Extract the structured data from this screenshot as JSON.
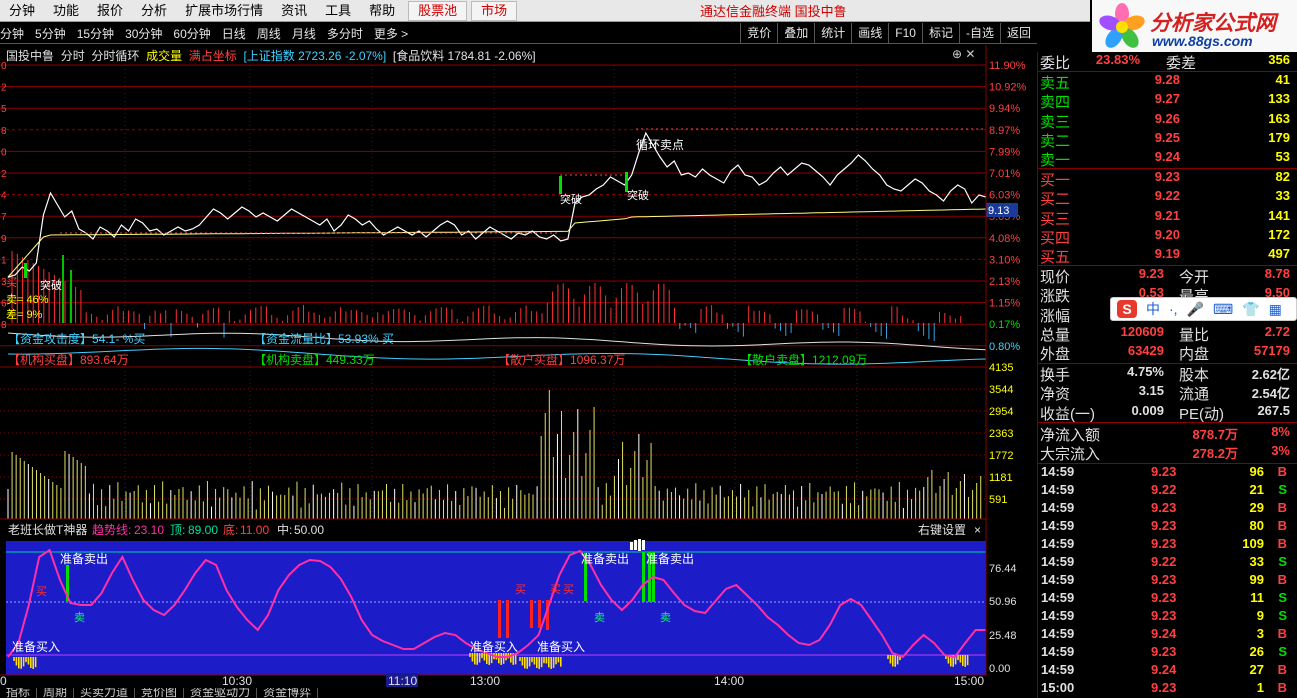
{
  "menu": {
    "items": [
      "分钟",
      "功能",
      "报价",
      "分析",
      "扩展市场行情",
      "资讯",
      "工具",
      "帮助"
    ],
    "stock_pool": "股票池",
    "market": "市场",
    "title": "通达信金融终端  国投中鲁"
  },
  "periods": [
    "分钟",
    "5分钟",
    "15分钟",
    "30分钟",
    "60分钟",
    "日线",
    "周线",
    "月线",
    "多分时",
    "更多 >"
  ],
  "tools": [
    "竞价",
    "叠加",
    "统计",
    "画线",
    "F10",
    "标记",
    "-自选",
    "返回"
  ],
  "logo": {
    "text": "分析家公式网",
    "url": "www.88gs.com"
  },
  "info": {
    "stock": "国投中鲁",
    "mode1": "分时",
    "mode2": "分时循环",
    "vol": "成交量",
    "coord": "满占坐标",
    "index": "[上证指数 2723.26 -2.07%]",
    "sector": "[食品饮料 1784.81 -2.06%]"
  },
  "price_axis": [
    "11.90%",
    "10.92%",
    "9.94%",
    "8.97%",
    "7.99%",
    "7.01%",
    "6.03%",
    "5.05%",
    "4.08%",
    "3.10%",
    "2.13%",
    "1.15%",
    "0.17%",
    "0.80%"
  ],
  "left_axis": [
    "0",
    "2",
    "5",
    "8",
    "0",
    "2",
    "4",
    "7",
    "9",
    "1",
    "3",
    "6",
    "8"
  ],
  "current_price_label": "9.13",
  "chart_labels": {
    "breakout1": "突破",
    "breakout2": "突破",
    "breakout3": "突破",
    "cycle_sell": "循环卖点",
    "sell_ratio": "卖= 46%",
    "diff_ratio": "差= 9%",
    "buy_marker": "买"
  },
  "flow_labels": {
    "attack": "【资金攻击度】54.1- %买",
    "flow_ratio": "【资金流量比】53.93% 买",
    "inst_buy": "【机构买盘】893.64万",
    "inst_sell": "【机构卖盘】449.33万",
    "retail_buy": "【散户买盘】1096.37万",
    "retail_sell": "【散户卖盘】1212.09万"
  },
  "volume_axis": [
    "4135",
    "3544",
    "2954",
    "2363",
    "1772",
    "1181",
    "591"
  ],
  "indicator": {
    "name": "老班长做T神器",
    "trend_label": "趋势线:",
    "trend_value": "23.10",
    "top_label": "顶:",
    "top_value": "89.00",
    "bottom_label": "底:",
    "bottom_value": "11.00",
    "mid_label": "中:",
    "mid_value": "50.00",
    "settings": "右键设置",
    "axis": [
      "76.44",
      "50.96",
      "25.48",
      "0.00"
    ],
    "ready_buy": "准备买入",
    "ready_sell": "准备卖出",
    "buy": "买",
    "sell": "卖"
  },
  "time_axis": [
    "0",
    "10:30",
    "11:10",
    "13:00",
    "14:00",
    "15:00"
  ],
  "bottom_tabs": [
    "指标",
    "周期",
    "买卖力道",
    "竞价图",
    "资金驱动力",
    "资金博弈"
  ],
  "quote": {
    "weibi": {
      "label": "委比",
      "value1": "23.83%",
      "label2": "委差",
      "value2": "356"
    },
    "ask": [
      {
        "label": "卖五",
        "price": "9.28",
        "vol": "41"
      },
      {
        "label": "卖四",
        "price": "9.27",
        "vol": "133"
      },
      {
        "label": "卖三",
        "price": "9.26",
        "vol": "163"
      },
      {
        "label": "卖二",
        "price": "9.25",
        "vol": "179"
      },
      {
        "label": "卖一",
        "price": "9.24",
        "vol": "53"
      }
    ],
    "bid": [
      {
        "label": "买一",
        "price": "9.23",
        "vol": "82"
      },
      {
        "label": "买二",
        "price": "9.22",
        "vol": "33"
      },
      {
        "label": "买三",
        "price": "9.21",
        "vol": "141"
      },
      {
        "label": "买四",
        "price": "9.20",
        "vol": "172"
      },
      {
        "label": "买五",
        "price": "9.19",
        "vol": "497"
      }
    ],
    "stats": [
      {
        "l1": "现价",
        "v1": "9.23",
        "l2": "今开",
        "v2": "8.78"
      },
      {
        "l1": "涨跌",
        "v1": "0.53",
        "l2": "最高",
        "v2": "9.50"
      },
      {
        "l1": "涨幅",
        "v1": "",
        "l2": "",
        "v2": ""
      },
      {
        "l1": "总量",
        "v1": "120609",
        "l2": "量比",
        "v2": "2.72"
      },
      {
        "l1": "外盘",
        "v1": "63429",
        "l2": "内盘",
        "v2": "57179"
      }
    ],
    "fund": [
      {
        "l1": "换手",
        "v1": "4.75%",
        "l2": "股本",
        "v2": "2.62亿"
      },
      {
        "l1": "净资",
        "v1": "3.15",
        "l2": "流通",
        "v2": "2.54亿"
      },
      {
        "l1": "收益(一)",
        "v1": "0.009",
        "l2": "PE(动)",
        "v2": "267.5"
      }
    ],
    "flow": [
      {
        "label": "净流入额",
        "value": "878.7万",
        "pct": "8%"
      },
      {
        "label": "大宗流入",
        "value": "278.2万",
        "pct": "3%"
      }
    ],
    "ticks": [
      {
        "t": "14:59",
        "p": "9.23",
        "q": "96",
        "bs": "B"
      },
      {
        "t": "14:59",
        "p": "9.22",
        "q": "21",
        "bs": "S"
      },
      {
        "t": "14:59",
        "p": "9.23",
        "q": "29",
        "bs": "B"
      },
      {
        "t": "14:59",
        "p": "9.23",
        "q": "80",
        "bs": "B"
      },
      {
        "t": "14:59",
        "p": "9.23",
        "q": "109",
        "bs": "B"
      },
      {
        "t": "14:59",
        "p": "9.22",
        "q": "33",
        "bs": "S"
      },
      {
        "t": "14:59",
        "p": "9.23",
        "q": "99",
        "bs": "B"
      },
      {
        "t": "14:59",
        "p": "9.23",
        "q": "11",
        "bs": "S"
      },
      {
        "t": "14:59",
        "p": "9.23",
        "q": "9",
        "bs": "S"
      },
      {
        "t": "14:59",
        "p": "9.24",
        "q": "3",
        "bs": "B"
      },
      {
        "t": "14:59",
        "p": "9.23",
        "q": "26",
        "bs": "S"
      },
      {
        "t": "14:59",
        "p": "9.24",
        "q": "27",
        "bs": "B"
      },
      {
        "t": "15:00",
        "p": "9.23",
        "q": "1",
        "bs": "B"
      }
    ]
  },
  "ime": [
    "S",
    "中",
    "·,",
    "🎤",
    "⌨",
    "👕",
    "▦"
  ],
  "colors": {
    "up": "#ff4040",
    "down": "#00e000",
    "grid": "#8b0000",
    "price_line": "#ffffff",
    "avg_line": "#ffff80",
    "osc_line": "#ff2fa8",
    "osc_bg": "#1c1cc8"
  }
}
